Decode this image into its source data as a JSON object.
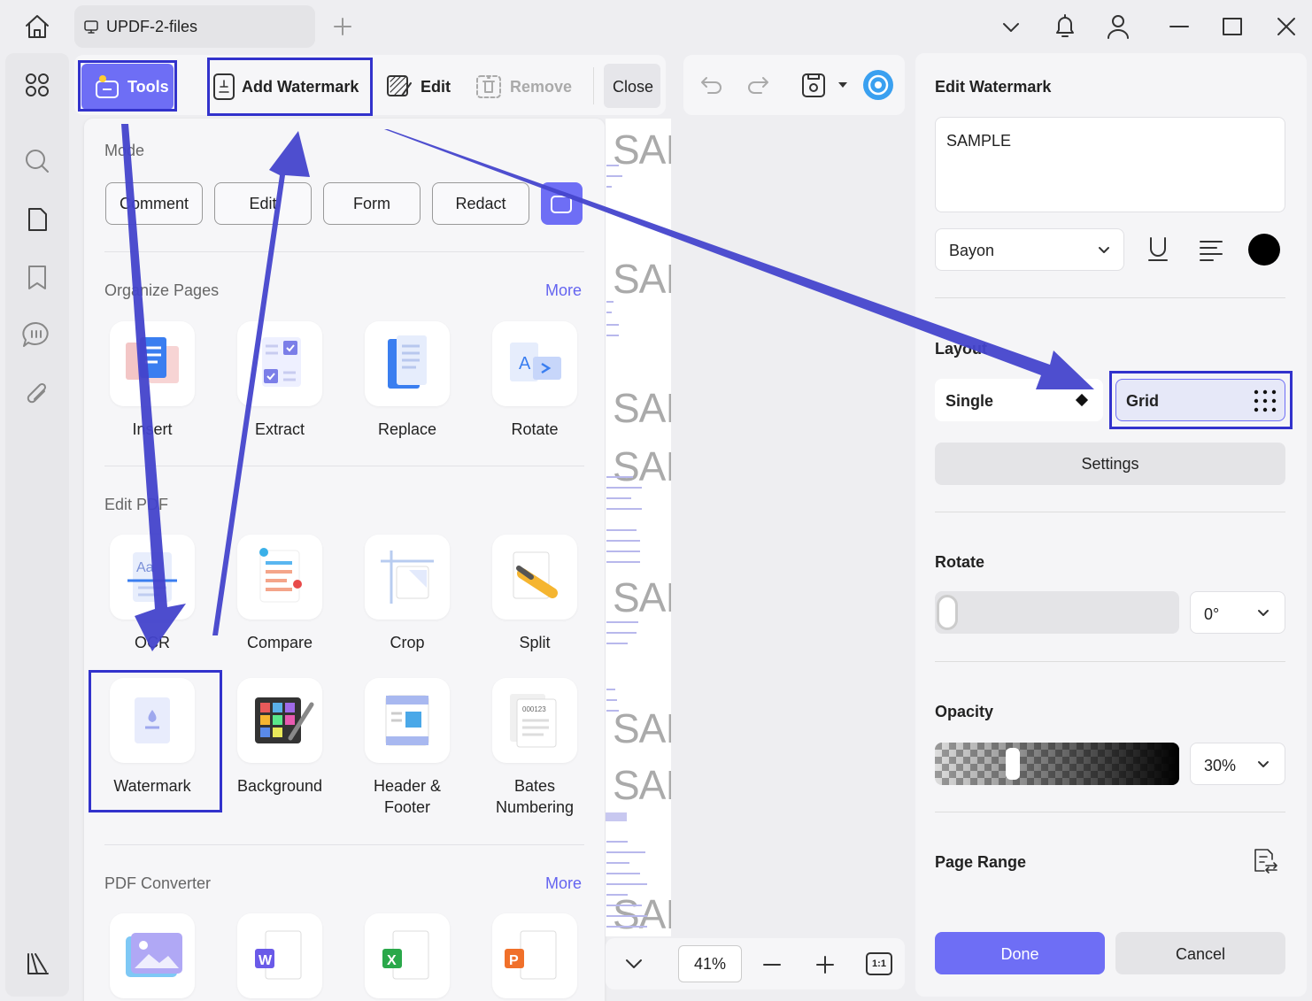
{
  "tab": {
    "title": "UPDF-2-files"
  },
  "toolbar": {
    "tools": "Tools",
    "add_watermark": "Add Watermark",
    "edit": "Edit",
    "remove": "Remove",
    "close": "Close"
  },
  "panel": {
    "mode": {
      "label": "Mode",
      "buttons": [
        "Comment",
        "Edit",
        "Form",
        "Redact"
      ]
    },
    "organize": {
      "label": "Organize Pages",
      "more": "More",
      "items": [
        "Insert",
        "Extract",
        "Replace",
        "Rotate"
      ]
    },
    "edit_pdf": {
      "label": "Edit PDF",
      "items": [
        "OCR",
        "Compare",
        "Crop",
        "Split",
        "Watermark",
        "Background",
        "Header & Footer",
        "Bates Numbering"
      ]
    },
    "converter": {
      "label": "PDF Converter",
      "more": "More"
    }
  },
  "preview": {
    "watermark_text": "SAI",
    "zoom": "41%",
    "fit_label": "1:1"
  },
  "edit_watermark": {
    "title": "Edit Watermark",
    "text_value": "SAMPLE",
    "font": "Bayon",
    "layout": {
      "label": "Layout",
      "single": "Single",
      "grid": "Grid"
    },
    "settings": "Settings",
    "rotate": {
      "label": "Rotate",
      "value": "0°",
      "fraction": 0
    },
    "opacity": {
      "label": "Opacity",
      "value": "30%",
      "fraction": 0.3
    },
    "page_range": "Page Range",
    "done": "Done",
    "cancel": "Cancel"
  },
  "colors": {
    "accent": "#6e6ef5",
    "highlight": "#3232cc",
    "watermark_color": "#000000"
  }
}
